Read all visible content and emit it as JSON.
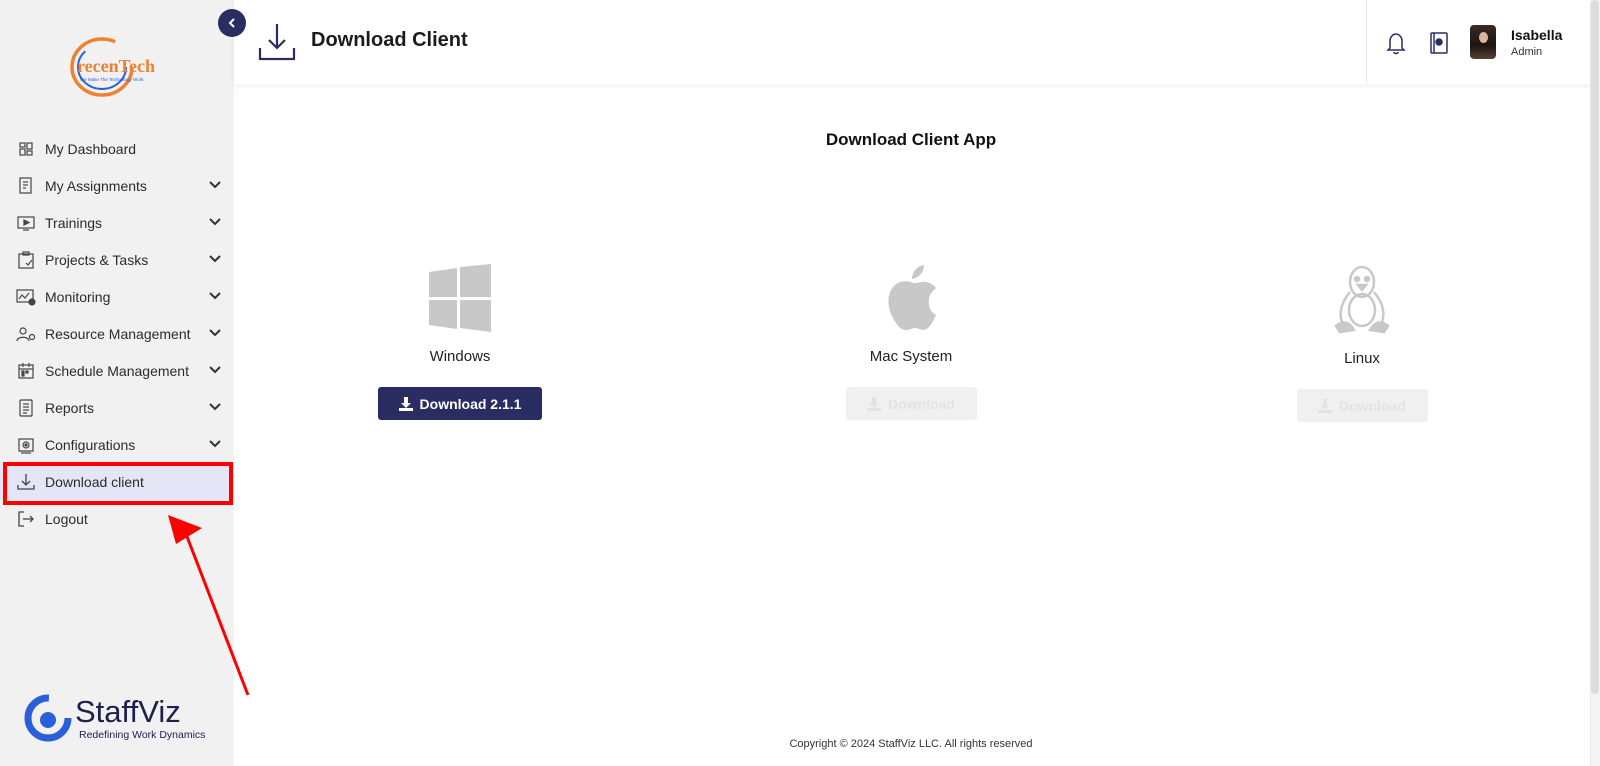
{
  "brand": {
    "name": "recenTech",
    "tagline": "We Make The Technology Work"
  },
  "sidebar": {
    "items": [
      {
        "label": "My Dashboard",
        "icon": "dashboard-icon",
        "has_submenu": false
      },
      {
        "label": "My Assignments",
        "icon": "assignments-icon",
        "has_submenu": true
      },
      {
        "label": "Trainings",
        "icon": "trainings-icon",
        "has_submenu": true
      },
      {
        "label": "Projects & Tasks",
        "icon": "clipboard-icon",
        "has_submenu": true
      },
      {
        "label": "Monitoring",
        "icon": "monitoring-icon",
        "has_submenu": true
      },
      {
        "label": "Resource Management",
        "icon": "resource-icon",
        "has_submenu": true
      },
      {
        "label": "Schedule Management",
        "icon": "schedule-icon",
        "has_submenu": true
      },
      {
        "label": "Reports",
        "icon": "reports-icon",
        "has_submenu": true
      },
      {
        "label": "Configurations",
        "icon": "configurations-icon",
        "has_submenu": true
      },
      {
        "label": "Download client",
        "icon": "download-icon",
        "has_submenu": false,
        "active": true
      },
      {
        "label": "Logout",
        "icon": "logout-icon",
        "has_submenu": false
      }
    ],
    "footer_brand": {
      "name": "StaffViz",
      "tagline": "Redefining Work Dynamics"
    }
  },
  "header": {
    "title": "Download Client",
    "user": {
      "name": "Isabella",
      "role": "Admin"
    }
  },
  "main": {
    "title": "Download Client App",
    "clients": [
      {
        "os": "Windows",
        "button_label": "Download 2.1.1",
        "enabled": true,
        "icon": "windows-logo-icon"
      },
      {
        "os": "Mac System",
        "button_label": "Download",
        "enabled": false,
        "icon": "apple-logo-icon"
      },
      {
        "os": "Linux",
        "button_label": "Download",
        "enabled": false,
        "icon": "linux-tux-icon"
      }
    ]
  },
  "footer": {
    "copyright": "Copyright © 2024 StaffViz LLC. All rights reserved"
  },
  "colors": {
    "accent": "#2a2d62",
    "active_bg": "#e4e5f7",
    "annotation": "#ff0000",
    "logo_blue": "#2b5fd9",
    "logo_orange": "#f0812f"
  }
}
